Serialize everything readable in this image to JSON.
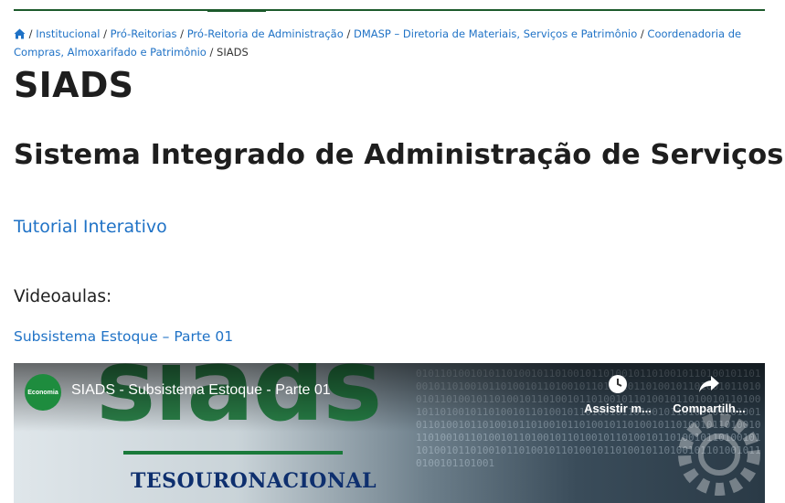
{
  "breadcrumb": {
    "items": [
      "Institucional",
      "Pró-Reitorias",
      "Pró-Reitoria de Administração",
      "DMASP – Diretoria de Materiais, Serviços e Patrimônio",
      "Coordenadoria de Compras, Almoxarifado e Patrimônio"
    ],
    "current": "SIADS",
    "separator": "/"
  },
  "page": {
    "title": "SIADS",
    "subtitle": "Sistema Integrado de Administração de Serviços",
    "tutorial_link": "Tutorial Interativo",
    "videoaulas_label": "Videoaulas:",
    "video_link": "Subsistema Estoque – Parte 01"
  },
  "video": {
    "title": "SIADS - Subsistema Estoque - Parte 01",
    "channel_logo_text": "Economia",
    "background_word": "siads",
    "brand_text": "TESOURONACIONAL",
    "watch_later_label": "Assistir m...",
    "share_label": "Compartilh..."
  },
  "colors": {
    "link": "#1f72c6",
    "accent_green": "#1c5a2b",
    "heading": "#1e1e1e"
  }
}
